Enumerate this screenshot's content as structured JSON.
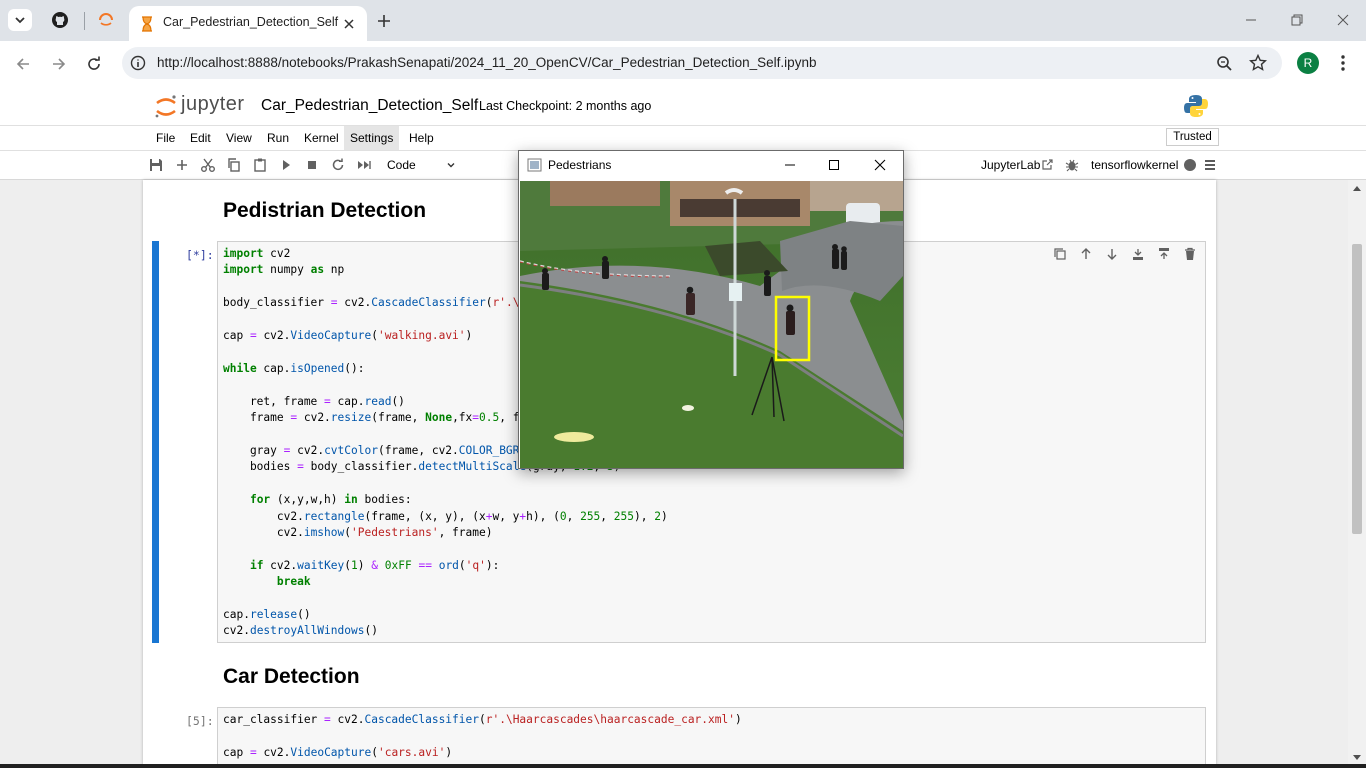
{
  "browser": {
    "tab_title": "Car_Pedestrian_Detection_Self",
    "url": "http://localhost:8888/notebooks/PrakashSenapati/2024_11_20_OpenCV/Car_Pedestrian_Detection_Self.ipynb",
    "profile_initial": "R",
    "profile_color": "#0b8043"
  },
  "jupyter": {
    "logo_text": "jupyter",
    "notebook_title": "Car_Pedestrian_Detection_Self",
    "checkpoint": "Last Checkpoint: 2 months ago",
    "menu": [
      "File",
      "Edit",
      "View",
      "Run",
      "Kernel",
      "Settings",
      "Help"
    ],
    "trusted": "Trusted",
    "cell_type": "Code",
    "jupyterlab_link": "JupyterLab",
    "kernel_name": "tensorflowkernel"
  },
  "notebook": {
    "heading1": "Pedistrian Detection",
    "cell1_prompt": "[*]:",
    "heading2": "Car Detection",
    "cell2_prompt": "[5]:"
  },
  "popup": {
    "title": "Pedestrians",
    "detection_color": "#ffff00"
  }
}
